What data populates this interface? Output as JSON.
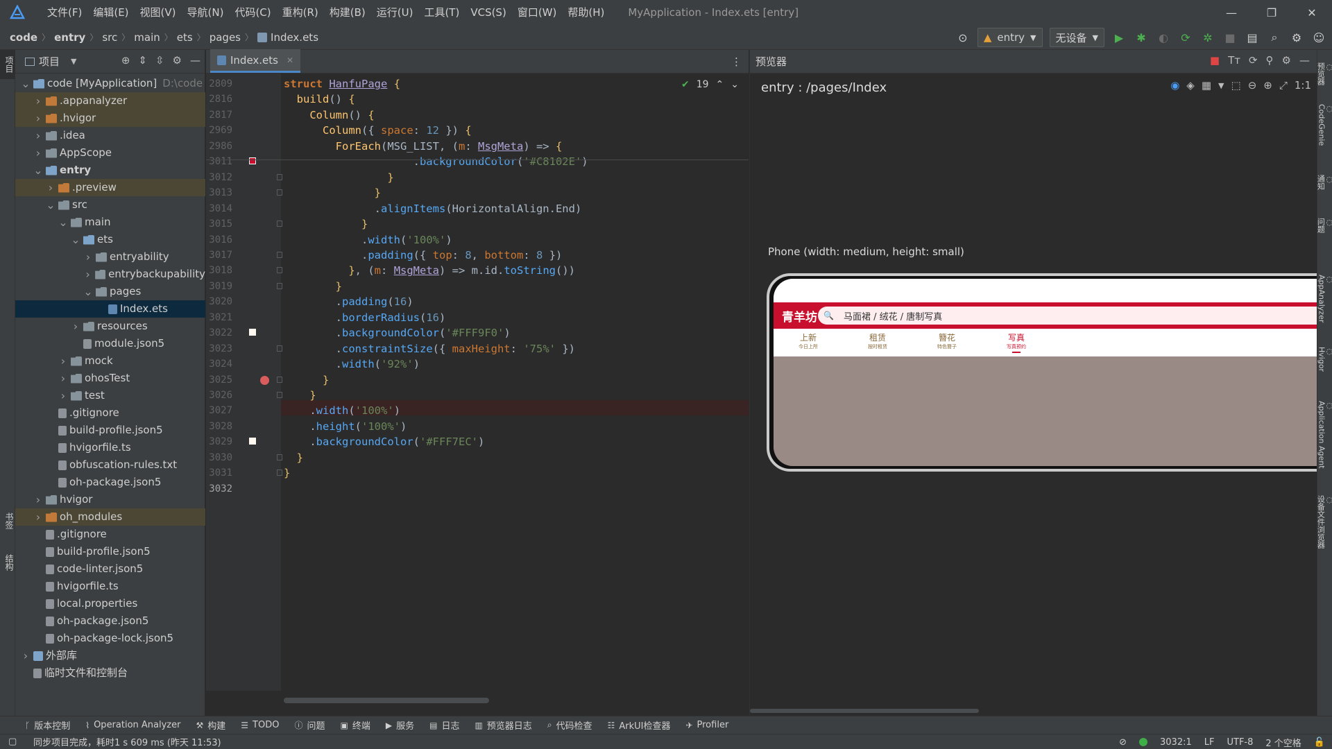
{
  "titlebar": {
    "menus": [
      "文件(F)",
      "编辑(E)",
      "视图(V)",
      "导航(N)",
      "代码(C)",
      "重构(R)",
      "构建(B)",
      "运行(U)",
      "工具(T)",
      "VCS(S)",
      "窗口(W)",
      "帮助(H)"
    ],
    "window_title": "MyApplication - Index.ets [entry]"
  },
  "breadcrumb": {
    "items": [
      "code",
      "entry",
      "src",
      "main",
      "ets",
      "pages",
      "Index.ets"
    ]
  },
  "run_toolbar": {
    "module": "entry",
    "device": "无设备"
  },
  "left_strip": {
    "project": "项目",
    "bookmarks": "书签",
    "structure": "结构"
  },
  "project_panel": {
    "title": "项目",
    "tree": [
      {
        "label": "code [MyApplication]",
        "secondary": "D:\\code",
        "indent": 0,
        "arrow": "v",
        "icon": "module"
      },
      {
        "label": ".appanalyzer",
        "indent": 1,
        "arrow": ">",
        "icon": "folder-orange",
        "hl": true
      },
      {
        "label": ".hvigor",
        "indent": 1,
        "arrow": ">",
        "icon": "folder-orange",
        "hl": true
      },
      {
        "label": ".idea",
        "indent": 1,
        "arrow": ">",
        "icon": "folder"
      },
      {
        "label": "AppScope",
        "indent": 1,
        "arrow": ">",
        "icon": "folder"
      },
      {
        "label": "entry",
        "indent": 1,
        "arrow": "v",
        "icon": "module",
        "bold": true
      },
      {
        "label": ".preview",
        "indent": 2,
        "arrow": ">",
        "icon": "folder-orange",
        "hl": true
      },
      {
        "label": "src",
        "indent": 2,
        "arrow": "v",
        "icon": "folder"
      },
      {
        "label": "main",
        "indent": 3,
        "arrow": "v",
        "icon": "folder"
      },
      {
        "label": "ets",
        "indent": 4,
        "arrow": "v",
        "icon": "module"
      },
      {
        "label": "entryability",
        "indent": 5,
        "arrow": ">",
        "icon": "folder"
      },
      {
        "label": "entrybackupability",
        "indent": 5,
        "arrow": ">",
        "icon": "folder"
      },
      {
        "label": "pages",
        "indent": 5,
        "arrow": "v",
        "icon": "folder"
      },
      {
        "label": "Index.ets",
        "indent": 6,
        "arrow": "",
        "icon": "ets",
        "sel": true
      },
      {
        "label": "resources",
        "indent": 4,
        "arrow": ">",
        "icon": "folder"
      },
      {
        "label": "module.json5",
        "indent": 4,
        "arrow": "",
        "icon": "file"
      },
      {
        "label": "mock",
        "indent": 3,
        "arrow": ">",
        "icon": "folder"
      },
      {
        "label": "ohosTest",
        "indent": 3,
        "arrow": ">",
        "icon": "folder"
      },
      {
        "label": "test",
        "indent": 3,
        "arrow": ">",
        "icon": "folder"
      },
      {
        "label": ".gitignore",
        "indent": 2,
        "arrow": "",
        "icon": "file"
      },
      {
        "label": "build-profile.json5",
        "indent": 2,
        "arrow": "",
        "icon": "file"
      },
      {
        "label": "hvigorfile.ts",
        "indent": 2,
        "arrow": "",
        "icon": "file"
      },
      {
        "label": "obfuscation-rules.txt",
        "indent": 2,
        "arrow": "",
        "icon": "file"
      },
      {
        "label": "oh-package.json5",
        "indent": 2,
        "arrow": "",
        "icon": "file"
      },
      {
        "label": "hvigor",
        "indent": 1,
        "arrow": ">",
        "icon": "folder"
      },
      {
        "label": "oh_modules",
        "indent": 1,
        "arrow": ">",
        "icon": "folder-orange",
        "hl": true
      },
      {
        "label": ".gitignore",
        "indent": 1,
        "arrow": "",
        "icon": "file"
      },
      {
        "label": "build-profile.json5",
        "indent": 1,
        "arrow": "",
        "icon": "file"
      },
      {
        "label": "code-linter.json5",
        "indent": 1,
        "arrow": "",
        "icon": "file"
      },
      {
        "label": "hvigorfile.ts",
        "indent": 1,
        "arrow": "",
        "icon": "file"
      },
      {
        "label": "local.properties",
        "indent": 1,
        "arrow": "",
        "icon": "file"
      },
      {
        "label": "oh-package.json5",
        "indent": 1,
        "arrow": "",
        "icon": "file"
      },
      {
        "label": "oh-package-lock.json5",
        "indent": 1,
        "arrow": "",
        "icon": "file"
      },
      {
        "label": "外部库",
        "indent": 0,
        "arrow": ">",
        "icon": "lib"
      },
      {
        "label": "临时文件和控制台",
        "indent": 0,
        "arrow": "",
        "icon": "file"
      }
    ]
  },
  "editor": {
    "tab_label": "Index.ets",
    "inspection_count": "19",
    "lines": [
      {
        "n": "2809",
        "html": "<span class='kw'>struct</span> <span class='ty'>HanfuPage</span> <span class='br'>{</span>"
      },
      {
        "n": "2816",
        "html": "  <span class='fn'>build</span>() <span class='br'>{</span>"
      },
      {
        "n": "2817",
        "html": "    <span class='fn'>Column</span>() <span class='br'>{</span>"
      },
      {
        "n": "2969",
        "html": "      <span class='fn'>Column</span>({ <span class='pm'>space</span>: <span class='num'>12</span> }) <span class='br'>{</span>"
      },
      {
        "n": "2986",
        "html": "        <span class='fn'>ForEach</span>(MSG_LIST, (<span class='pm'>m</span>: <span class='ty'>MsgMeta</span>) => <span class='br'>{</span>"
      },
      {
        "n": "3011",
        "html": "                    .<span class='mt'>backgroundColor</span>(<span class='str'>'#C8102E'</span>)"
      },
      {
        "n": "3012",
        "html": "                <span class='br'>}</span>"
      },
      {
        "n": "3013",
        "html": "              <span class='br'>}</span>"
      },
      {
        "n": "3014",
        "html": "              .<span class='mt'>alignItems</span>(HorizontalAlign.End)"
      },
      {
        "n": "3015",
        "html": "            <span class='br'>}</span>"
      },
      {
        "n": "3016",
        "html": "            .<span class='mt'>width</span>(<span class='str'>'100%'</span>)"
      },
      {
        "n": "3017",
        "html": "            .<span class='mt'>padding</span>({ <span class='pm'>top</span>: <span class='num'>8</span>, <span class='pm'>bottom</span>: <span class='num'>8</span> })"
      },
      {
        "n": "3018",
        "html": "          <span class='br'>}</span>, (<span class='pm'>m</span>: <span class='ty'>MsgMeta</span>) => m.id.<span class='mt'>toString</span>())"
      },
      {
        "n": "3019",
        "html": "        <span class='br'>}</span>"
      },
      {
        "n": "3020",
        "html": "        .<span class='mt'>padding</span>(<span class='num'>16</span>)"
      },
      {
        "n": "3021",
        "html": "        .<span class='mt'>borderRadius</span>(<span class='num'>16</span>)"
      },
      {
        "n": "3022",
        "html": "        .<span class='mt'>backgroundColor</span>(<span class='str'>'#FFF9F0'</span>)"
      },
      {
        "n": "3023",
        "html": "        .<span class='mt'>constraintSize</span>({ <span class='pm'>maxHeight</span>: <span class='str'>'75%'</span> })"
      },
      {
        "n": "3024",
        "html": "        .<span class='mt'>width</span>(<span class='str'>'92%'</span>)"
      },
      {
        "n": "3025",
        "html": "      <span class='br'>}</span>"
      },
      {
        "n": "3026",
        "html": "    <span class='br'>}</span>"
      },
      {
        "n": "3027",
        "html": "    .<span class='mt'>width</span>(<span class='str'>'100%'</span>)"
      },
      {
        "n": "3028",
        "html": "    .<span class='mt'>height</span>(<span class='str'>'100%'</span>)"
      },
      {
        "n": "3029",
        "html": "    .<span class='mt'>backgroundColor</span>(<span class='str'>'#FFF7EC'</span>)"
      },
      {
        "n": "3030",
        "html": "  <span class='br'>}</span>"
      },
      {
        "n": "3031",
        "html": "<span class='br'>}</span>"
      },
      {
        "n": "3032",
        "html": ""
      }
    ]
  },
  "preview": {
    "title": "预览器",
    "route": "entry : /pages/Index",
    "device_label": "Phone (width: medium, height: small)",
    "app": {
      "brand": "青羊坊",
      "search_placeholder": "马面裙 / 绒花 / 唐制写真",
      "tabs": [
        {
          "main": "上新",
          "sub": "今日上所",
          "active": false
        },
        {
          "main": "租赁",
          "sub": "按时租赁",
          "active": false
        },
        {
          "main": "簪花",
          "sub": "特色簪子",
          "active": false
        },
        {
          "main": "写真",
          "sub": "写真预约",
          "active": true
        }
      ],
      "colors": {
        "header": "#C8102E",
        "tab_text": "#8A6A3A",
        "content_bg": "#9A8A86"
      }
    }
  },
  "right_strip": {
    "items": [
      "预览器",
      "CodeGenie",
      "通知",
      "问题",
      "AppAnalyzer",
      "Hvigor",
      "Application Agent",
      "设备文件浏览器"
    ]
  },
  "bottom_tools": [
    {
      "label": "版本控制",
      "icon": "branch-icon"
    },
    {
      "label": "Operation Analyzer",
      "icon": "chart-icon"
    },
    {
      "label": "构建",
      "icon": "hammer-icon"
    },
    {
      "label": "TODO",
      "icon": "list-icon"
    },
    {
      "label": "问题",
      "icon": "info-icon"
    },
    {
      "label": "终端",
      "icon": "terminal-icon"
    },
    {
      "label": "服务",
      "icon": "play-icon"
    },
    {
      "label": "日志",
      "icon": "log-icon"
    },
    {
      "label": "预览器日志",
      "icon": "doc-icon"
    },
    {
      "label": "代码检查",
      "icon": "inspect-icon"
    },
    {
      "label": "ArkUI检查器",
      "icon": "tree-icon"
    },
    {
      "label": "Profiler",
      "icon": "profiler-icon"
    }
  ],
  "statusbar": {
    "message": "同步项目完成，耗时1 s 609 ms (昨天 11:53)",
    "position": "3032:1",
    "line_sep": "LF",
    "encoding": "UTF-8",
    "indent": "2 个空格"
  }
}
